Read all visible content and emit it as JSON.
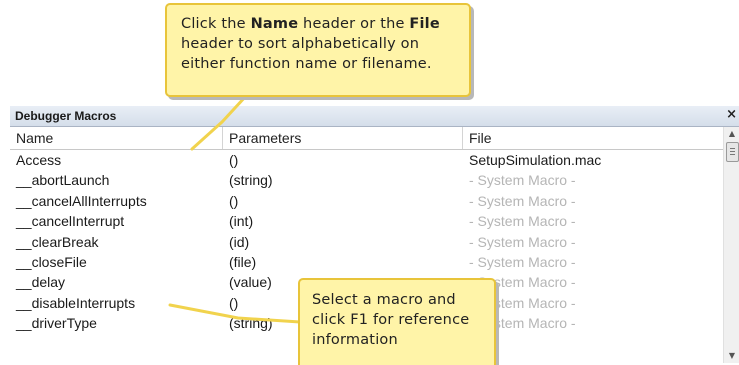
{
  "window": {
    "title": "Debugger Macros",
    "close_glyph": "×"
  },
  "table": {
    "columns": [
      "Name",
      "Parameters",
      "File"
    ],
    "rows": [
      {
        "name": "Access",
        "params": "()",
        "file": "SetupSimulation.mac",
        "system": false
      },
      {
        "name": "__abortLaunch",
        "params": "(string)",
        "file": "- System Macro -",
        "system": true
      },
      {
        "name": "__cancelAllInterrupts",
        "params": "()",
        "file": "- System Macro -",
        "system": true
      },
      {
        "name": "__cancelInterrupt",
        "params": "(int)",
        "file": "- System Macro -",
        "system": true
      },
      {
        "name": "__clearBreak",
        "params": "(id)",
        "file": "- System Macro -",
        "system": true
      },
      {
        "name": "__closeFile",
        "params": "(file)",
        "file": "- System Macro -",
        "system": true
      },
      {
        "name": "__delay",
        "params": "(value)",
        "file": "- System Macro -",
        "system": true
      },
      {
        "name": "__disableInterrupts",
        "params": "()",
        "file": "- System Macro -",
        "system": true
      },
      {
        "name": "__driverType",
        "params": "(string)",
        "file": "- System Macro -",
        "system": true
      }
    ]
  },
  "callouts": {
    "top": {
      "line1_pre": "Click the ",
      "line1_bold1": "Name",
      "line1_mid": " header or the ",
      "line1_bold2": "File",
      "line2": "header to sort alphabetically on",
      "line3": "either function name or filename."
    },
    "bottom": {
      "line1": "Select a macro and",
      "line2": "click F1 for reference",
      "line3": "information"
    }
  },
  "icons": {
    "scroll_up": "scroll-up-arrow-icon",
    "scroll_down": "scroll-down-arrow-icon"
  },
  "colors": {
    "callout_fill": "#fff4a8",
    "callout_border": "#e8c43a",
    "system_macro_text": "#b5b5b5",
    "titlebar": "#d5deea"
  }
}
